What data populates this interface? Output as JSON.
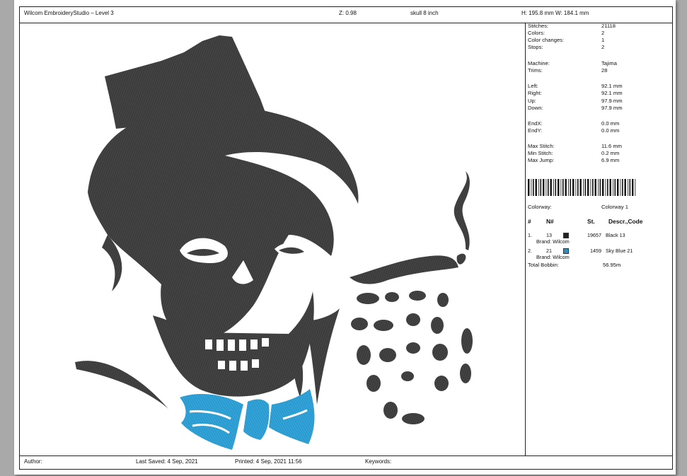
{
  "header": {
    "title": "Wilcom EmbroideryStudio – Level 3",
    "zoom": "Z: 0.98",
    "design_name": "skull 8 inch",
    "dimensions": "H: 195.8 mm  W: 184.1 mm"
  },
  "stats": [
    {
      "label": "Stitches:",
      "value": "21118"
    },
    {
      "label": "Colors:",
      "value": "2"
    },
    {
      "label": "Color changes:",
      "value": "1"
    },
    {
      "label": "Stops:",
      "value": "2"
    },
    {
      "label": "Machine:",
      "value": "Tajima"
    },
    {
      "label": "Trims:",
      "value": "28"
    },
    {
      "label": "Left:",
      "value": "92.1 mm"
    },
    {
      "label": "Right:",
      "value": "92.1 mm"
    },
    {
      "label": "Up:",
      "value": "97.9 mm"
    },
    {
      "label": "Down:",
      "value": "97.9 mm"
    },
    {
      "label": "EndX:",
      "value": "0.0 mm"
    },
    {
      "label": "EndY:",
      "value": "0.0 mm"
    },
    {
      "label": "Max Stitch:",
      "value": "11.6 mm"
    },
    {
      "label": "Min Stitch:",
      "value": "0.2 mm"
    },
    {
      "label": "Max Jump:",
      "value": "6.9 mm"
    }
  ],
  "colorway": {
    "label": "Colorway:",
    "value": "Colorway 1"
  },
  "color_table": {
    "headers": {
      "num": "#",
      "n": "N#",
      "st": "St.",
      "desc": "Descr.,Code"
    },
    "entries": [
      {
        "index": "1.",
        "n": "13",
        "stitches": "19657",
        "desc": "Black 13",
        "brand": "Brand: Wilcom",
        "color": "#222222"
      },
      {
        "index": "2.",
        "n": "21",
        "stitches": "1459",
        "desc": "Sky Blue 21",
        "brand": "Brand: Wilcom",
        "color": "#2a8fc2"
      }
    ],
    "total_label": "Total Bobbin:",
    "total_value": "56.95m"
  },
  "footer": {
    "author": "Author:",
    "last_saved": "Last Saved:  4 Sep, 2021",
    "printed": "Printed:  4 Sep, 2021 11:56",
    "keywords": "Keywords:"
  },
  "colors": {
    "stitch_dark": "#3c3c3c",
    "stitch_blue": "#2a9bd0"
  }
}
